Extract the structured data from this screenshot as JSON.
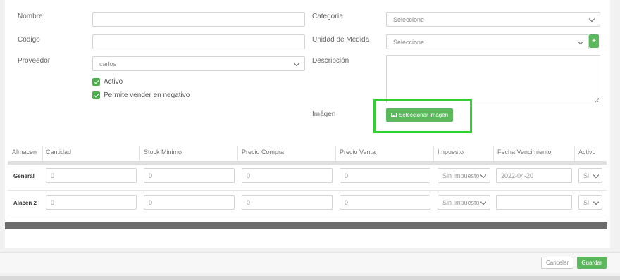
{
  "form": {
    "nombre_label": "Nombre",
    "nombre_value": "",
    "codigo_label": "Código",
    "codigo_value": "",
    "proveedor_label": "Proveedor",
    "proveedor_value": "carlos",
    "activo_label": "Activo",
    "activo_checked": true,
    "negativo_label": "Permite vender en negativo",
    "negativo_checked": true,
    "categoria_label": "Categoría",
    "categoria_value": "Seleccione",
    "unidad_label": "Unidad de Medida",
    "unidad_value": "Seleccione",
    "unidad_add_icon": "plus-icon",
    "descripcion_label": "Descripción",
    "descripcion_value": "",
    "imagen_label": "Imágen",
    "imagen_button": "Seleccionar imágen",
    "imagen_icon": "image-icon"
  },
  "table": {
    "headers": [
      "Almacen",
      "Cantidad",
      "Stock Minimo",
      "Precio Compra",
      "Precio Venta",
      "Impuesto",
      "Fecha Vencimiento",
      "Activo"
    ],
    "rows": [
      {
        "almacen": "General",
        "cantidad": "0",
        "stock_minimo": "0",
        "precio_compra": "0",
        "precio_venta": "0",
        "impuesto": "Sin Impuesto",
        "fecha": "2022-04-20",
        "activo": "Si"
      },
      {
        "almacen": "Alacen 2",
        "cantidad": "0",
        "stock_minimo": "0",
        "precio_compra": "0",
        "precio_venta": "0",
        "impuesto": "Sin Impuesto",
        "fecha": "",
        "activo": "Si"
      }
    ]
  },
  "footer": {
    "cancel_label": "Cancelar",
    "save_label": "Guardar"
  },
  "colors": {
    "accent": "#5cb85c",
    "highlight": "#2dd32d"
  }
}
